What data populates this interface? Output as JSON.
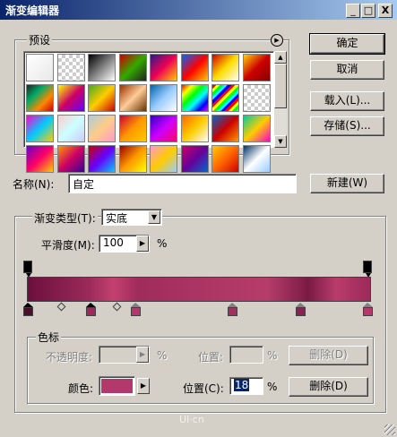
{
  "window": {
    "title": "渐变编辑器",
    "min_label": "_",
    "max_label": "□",
    "close_label": "X"
  },
  "presets": {
    "label": "预设",
    "menu_icon": "circle-arrow-right-icon",
    "scroll_up": "▲",
    "scroll_down": "▼",
    "swatches": [
      "linear-gradient(135deg,#ffffff,#e8e8e8)",
      "repeating-conic-gradient(#ccc 0 25%,#fff 0 50%) 0 0/8px 8px",
      "linear-gradient(135deg,#000,#fff)",
      "linear-gradient(135deg,#c00,#3a0,#222)",
      "linear-gradient(135deg,#2a1a8a,#e05,#fc0)",
      "linear-gradient(135deg,#06f,#f00,#fc0)",
      "linear-gradient(135deg,#c00,#fd0,#fff)",
      "linear-gradient(135deg,#ffd000,#c00,#800)",
      "linear-gradient(135deg,#222,#0a6,#f80,#c00)",
      "linear-gradient(135deg,#ff0,#c06,#60f)",
      "linear-gradient(135deg,#4a2,#fc0,#c00)",
      "linear-gradient(135deg,#930,#fc9,#630)",
      "linear-gradient(135deg,#06a,#9cf,#fff)",
      "linear-gradient(135deg,#f00,#ff0,#0f0,#0ff,#00f,#f0f)",
      "repeating-linear-gradient(135deg,#f00 0 3px,#ff0 3px 6px,#0f0 6px 9px,#0ff 9px 12px,#00f 12px 15px)",
      "repeating-conic-gradient(#ccc 0 25%,#fff 0 50%) 0 0/8px 8px",
      "linear-gradient(135deg,#f0c,#0cf,#fc0)",
      "linear-gradient(135deg,#fcc,#cff,#ccf)",
      "linear-gradient(135deg,#acd,#fc8,#f9c)",
      "linear-gradient(135deg,#c03,#f90,#fc0)",
      "linear-gradient(135deg,#30c,#c0f,#f06)",
      "linear-gradient(135deg,#f60,#fc0,#fff)",
      "linear-gradient(135deg,#06c,#c00,#f90)",
      "linear-gradient(135deg,#0c9,#fc0,#f0c)",
      "linear-gradient(135deg,#60c,#f06,#fc0)",
      "linear-gradient(135deg,#f90,#c06,#309)",
      "linear-gradient(135deg,#c00,#60f,#0cf)",
      "linear-gradient(135deg,#900,#f90,#ff0)",
      "linear-gradient(135deg,#f9c,#fc0,#9cf)",
      "linear-gradient(135deg,#c06,#609,#06c)",
      "linear-gradient(135deg,#fc0,#f60,#c00)",
      "linear-gradient(135deg,#036,#fff,#9cf)"
    ]
  },
  "buttons": {
    "ok": "确定",
    "cancel": "取消",
    "load": "载入(L)...",
    "save": "存储(S)...",
    "new": "新建(W)"
  },
  "name": {
    "label": "名称(N):",
    "value": "自定"
  },
  "gradient_type": {
    "label": "渐变类型(T):",
    "value": "实底",
    "dropdown_icon": "▼"
  },
  "smoothness": {
    "label": "平滑度(M):",
    "value": "100",
    "unit": "%",
    "arrow": "▶"
  },
  "gradient_bar": {
    "opacity_stops": [
      0,
      100
    ],
    "color_stops": [
      0,
      18,
      32,
      62,
      80,
      100
    ],
    "midpoints": [
      10,
      26
    ],
    "colors": {
      "bar_dark": "#6c0f3d",
      "bar_light": "#c4416f",
      "stop_dark": "#3a0a20",
      "stop_main": "#9b2a5a"
    }
  },
  "color_stop_panel": {
    "label": "色标",
    "opacity_label": "不透明度:",
    "opacity_unit": "%",
    "location_label_top": "位置:",
    "location_unit_top": "%",
    "delete_top": "删除(D)",
    "color_label": "颜色:",
    "color_value": "#b3386c",
    "location_label": "位置(C):",
    "location_value": "18",
    "location_unit": "%",
    "delete": "删除(D)"
  },
  "watermark": "UI·cn"
}
